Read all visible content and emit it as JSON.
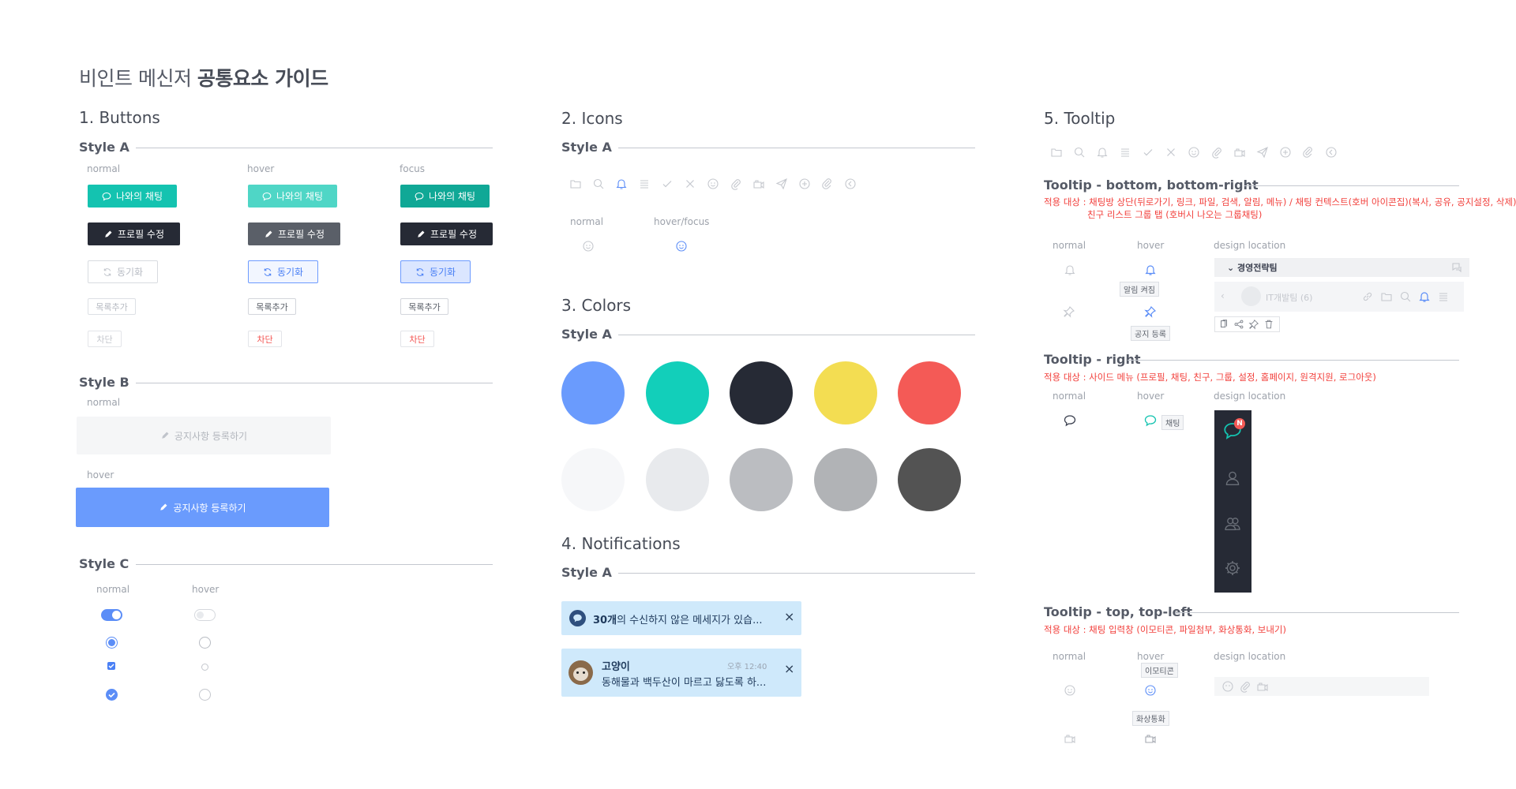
{
  "title": {
    "normal": "비인트 메신저 ",
    "bold": "공통요소 가이드"
  },
  "buttons": {
    "heading": "1. Buttons",
    "style_a": "Style A",
    "states": [
      "normal",
      "hover",
      "focus"
    ],
    "chat_label": "나와의 채팅",
    "profile_label": "프로필 수정",
    "sync_label": "동기화",
    "add_list_label": "목록추가",
    "block_label": "차단",
    "style_b": "Style B",
    "b_normal": "normal",
    "b_hover": "hover",
    "notice_label": "공지사항 등록하기",
    "style_c": "Style C",
    "c_normal": "normal",
    "c_hover": "hover"
  },
  "icons": {
    "heading": "2. Icons",
    "style_a": "Style A",
    "normal": "normal",
    "hover_focus": "hover/focus",
    "list": [
      "folder-icon",
      "search-icon",
      "bell-icon",
      "menu-icon",
      "check-icon",
      "close-icon",
      "emoji-icon",
      "attach-icon",
      "camera-icon",
      "send-icon",
      "add-icon",
      "clip-icon",
      "back-icon"
    ]
  },
  "colors": {
    "heading": "3. Colors",
    "style_a": "Style A",
    "row1": [
      "#6a9bfd",
      "#12cfba",
      "#262a35",
      "#f3dd52",
      "#f45a56"
    ],
    "row2": [
      "#f6f7f9",
      "#e8eaed",
      "#bbbdc1",
      "#b1b3b6",
      "#535353"
    ]
  },
  "notifications": {
    "heading": "4. Notifications",
    "style_a": "Style A",
    "n1_count": "30개",
    "n1_text": "의 수신하지 않은 메세지가 있습...",
    "n2_name": "고양이",
    "n2_time": "오후 12:40",
    "n2_text": "동해물과 백두산이 마르고 닳도록 하...",
    "close": "×"
  },
  "tooltip": {
    "heading": "5. Tooltip",
    "bottom": {
      "title": "Tooltip - bottom, bottom-right",
      "desc1": "적용 대상 : 채팅방 상단(뒤로가기, 링크, 파일, 검색, 알림, 메뉴) / 채팅 컨텍스트(호버 아이콘집)(복사, 공유, 공지설정, 삭제) /",
      "desc2": "친구 리스트 그룹 탭 (호버시 나오는 그룹채팅)",
      "normal": "normal",
      "hover": "hover",
      "design": "design location",
      "tip1": "알림 켜짐",
      "tip2": "공지 등록",
      "group_name": "경영전략팀",
      "room_name": "IT개발팀 (6)"
    },
    "right": {
      "title": "Tooltip - right",
      "desc": "적용 대상 : 사이드 메뉴 (프로필, 채팅, 친구, 그룹, 설정, 홈페이지, 원격지원, 로그아웃)",
      "normal": "normal",
      "hover": "hover",
      "design": "design location",
      "tip": "채팅",
      "badge": "N"
    },
    "top": {
      "title": "Tooltip - top, top-left",
      "desc": "적용 대상 : 채팅 입력창 (이모티콘, 파일첨부, 화상통화, 보내기)",
      "normal": "normal",
      "hover": "hover",
      "design": "design location",
      "tip1": "이모티콘",
      "tip2": "화상통화"
    }
  }
}
